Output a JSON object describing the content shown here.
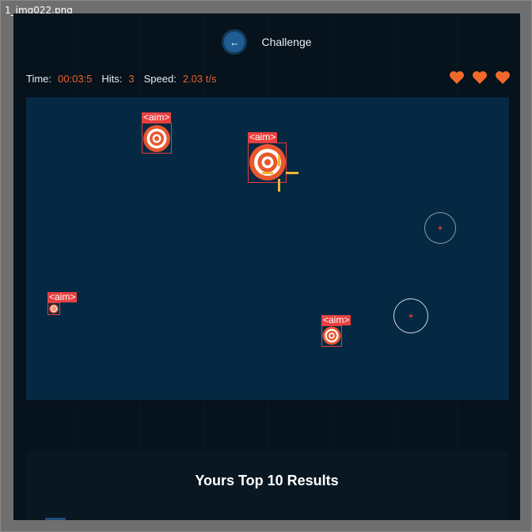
{
  "file": {
    "name": "1_img022.png"
  },
  "header": {
    "back_icon": "←",
    "title": "Challenge"
  },
  "stats": {
    "time_label": "Time:",
    "time_value": "00:03:5",
    "hits_label": "Hits:",
    "hits_value": "3",
    "speed_label": "Speed:",
    "speed_value": "2.03 t/s"
  },
  "lives": {
    "count": 3,
    "color": "#f0692b"
  },
  "targets": [
    {
      "label": "<aim>"
    },
    {
      "label": "<aim>"
    },
    {
      "label": "<aim>"
    },
    {
      "label": "<aim>"
    }
  ],
  "results": {
    "title": "Yours Top 10 Results"
  },
  "colors": {
    "accent": "#e8612c",
    "board": "#062943",
    "background": "#06121c",
    "target_red": "#e8572d"
  }
}
